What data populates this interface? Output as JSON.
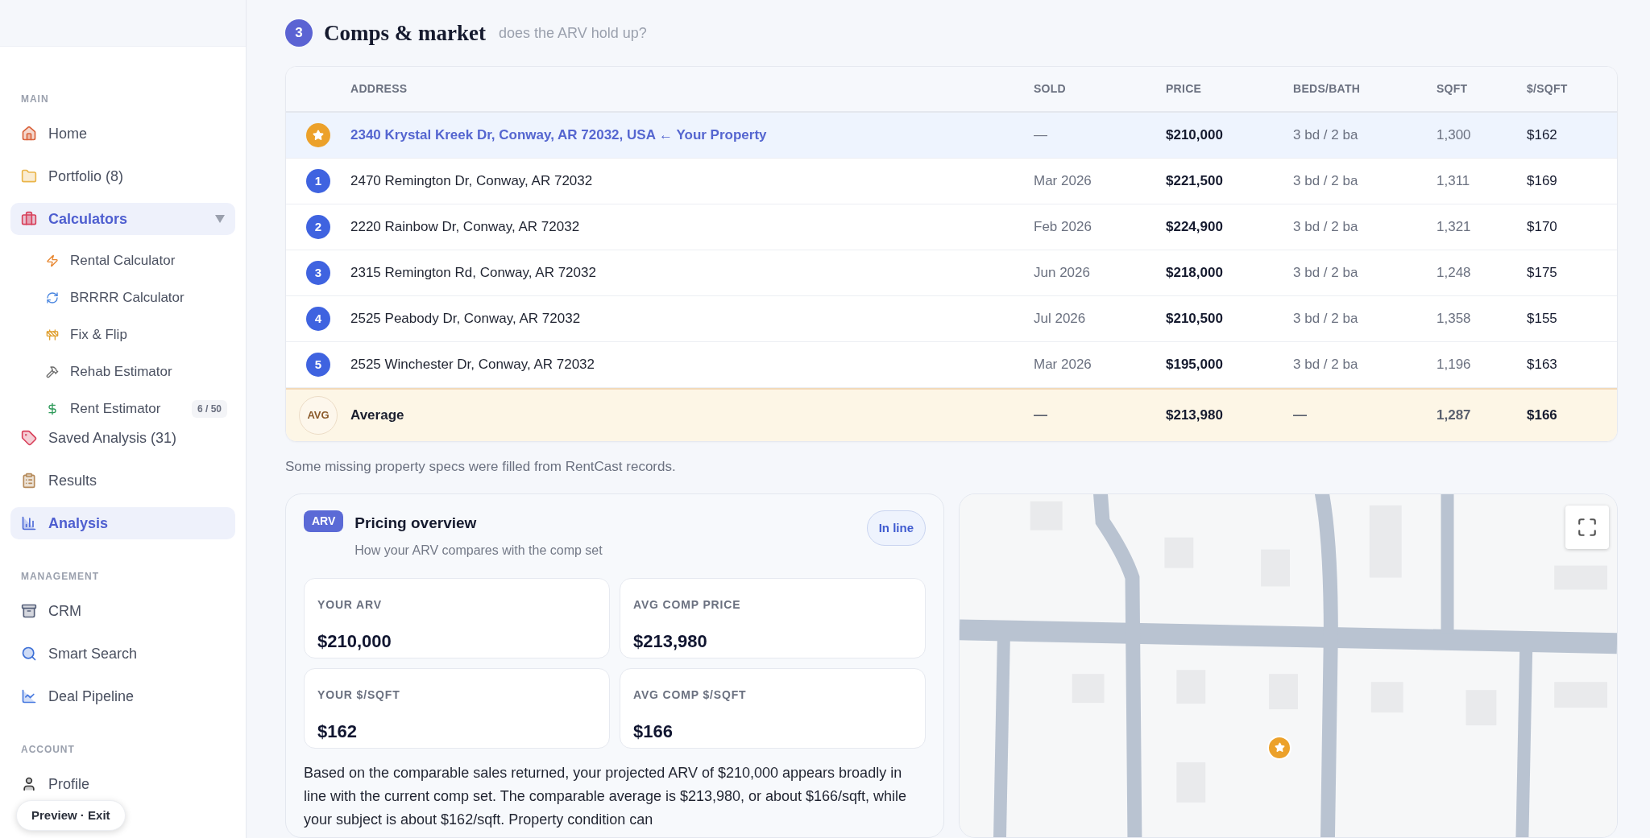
{
  "sidebar": {
    "sections": [
      {
        "title": "MAIN",
        "items": [
          {
            "label": "Home",
            "selected": false
          },
          {
            "label": "Portfolio (8)",
            "selected": false
          },
          {
            "label": "Calculators",
            "selected": true,
            "expanded": true,
            "children": [
              {
                "label": "Rental Calculator"
              },
              {
                "label": "BRRRR Calculator"
              },
              {
                "label": "Fix & Flip"
              },
              {
                "label": "Rehab Estimator"
              },
              {
                "label": "Rent Estimator",
                "badge": "6 / 50"
              }
            ]
          },
          {
            "label": "Saved Analysis (31)",
            "selected": false
          },
          {
            "label": "Results",
            "selected": false
          },
          {
            "label": "Analysis",
            "selected": true
          }
        ]
      },
      {
        "title": "MANAGEMENT",
        "items": [
          {
            "label": "CRM",
            "selected": false
          },
          {
            "label": "Smart Search",
            "selected": false
          },
          {
            "label": "Deal Pipeline",
            "selected": false
          }
        ]
      },
      {
        "title": "ACCOUNT",
        "items": [
          {
            "label": "Profile",
            "selected": false
          }
        ]
      }
    ],
    "preview_button": "Preview · Exit"
  },
  "section": {
    "number": "3",
    "title": "Comps & market",
    "subtitle": "does the ARV hold up?"
  },
  "table": {
    "columns": [
      "ADDRESS",
      "SOLD",
      "PRICE",
      "BEDS/BATH",
      "SQFT",
      "$/SQFT"
    ],
    "rows": [
      {
        "kind": "subject",
        "marker": "",
        "address": "2340 Krystal Kreek Dr, Conway, AR 72032, USA ← Your Property",
        "sold": "—",
        "price": "$210,000",
        "beds_bath": "3 bd / 2 ba",
        "sqft": "1,300",
        "price_per_sqft": "$162"
      },
      {
        "kind": "comp",
        "marker": "1",
        "address": "2470 Remington Dr, Conway, AR 72032",
        "sold": "Mar 2026",
        "price": "$221,500",
        "beds_bath": "3 bd / 2 ba",
        "sqft": "1,311",
        "price_per_sqft": "$169"
      },
      {
        "kind": "comp",
        "marker": "2",
        "address": "2220 Rainbow Dr, Conway, AR 72032",
        "sold": "Feb 2026",
        "price": "$224,900",
        "beds_bath": "3 bd / 2 ba",
        "sqft": "1,321",
        "price_per_sqft": "$170"
      },
      {
        "kind": "comp",
        "marker": "3",
        "address": "2315 Remington Rd, Conway, AR 72032",
        "sold": "Jun 2026",
        "price": "$218,000",
        "beds_bath": "3 bd / 2 ba",
        "sqft": "1,248",
        "price_per_sqft": "$175"
      },
      {
        "kind": "comp",
        "marker": "4",
        "address": "2525 Peabody Dr, Conway, AR 72032",
        "sold": "Jul 2026",
        "price": "$210,500",
        "beds_bath": "3 bd / 2 ba",
        "sqft": "1,358",
        "price_per_sqft": "$155"
      },
      {
        "kind": "comp",
        "marker": "5",
        "address": "2525 Winchester Dr, Conway, AR 72032",
        "sold": "Mar 2026",
        "price": "$195,000",
        "beds_bath": "3 bd / 2 ba",
        "sqft": "1,196",
        "price_per_sqft": "$163"
      },
      {
        "kind": "average",
        "marker": "AVG",
        "address": "Average",
        "sold": "—",
        "price": "$213,980",
        "beds_bath": "—",
        "sqft": "1,287",
        "price_per_sqft": "$166"
      }
    ]
  },
  "note": "Some missing property specs were filled from RentCast records.",
  "pricing": {
    "badge": "ARV",
    "title": "Pricing overview",
    "subtitle": "How your ARV compares with the comp set",
    "status": "In line",
    "stats": [
      {
        "label": "YOUR ARV",
        "value": "$210,000"
      },
      {
        "label": "AVG COMP PRICE",
        "value": "$213,980"
      },
      {
        "label": "YOUR $/SQFT",
        "value": "$162"
      },
      {
        "label": "AVG COMP $/SQFT",
        "value": "$166"
      }
    ],
    "summary": "Based on the comparable sales returned, your projected ARV of $210,000 appears broadly in line with the current comp set. The comparable average is $213,980, or about $166/sqft, while your subject is about $162/sqft. Property condition can"
  }
}
